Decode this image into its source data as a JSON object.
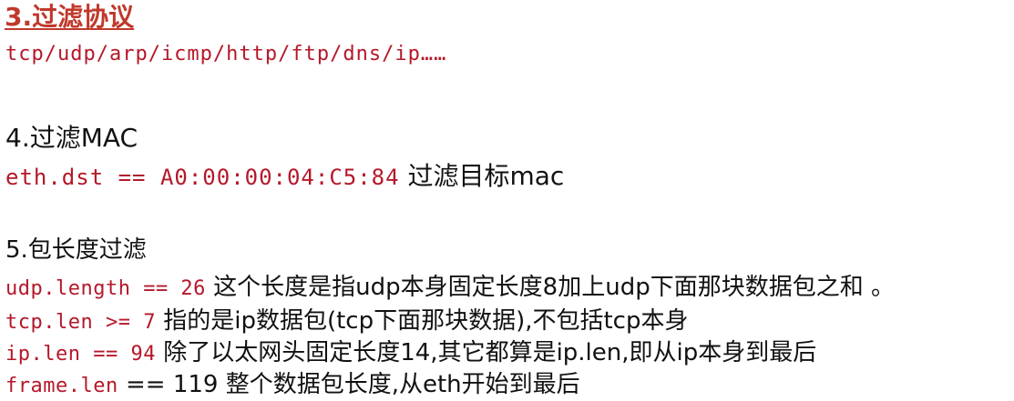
{
  "section3": {
    "heading": "3.过滤协议",
    "protocols": "tcp/udp/arp/icmp/http/ftp/dns/ip……"
  },
  "section4": {
    "heading": "4.过滤MAC",
    "code": "eth.dst == A0:00:00:04:C5:84",
    "description": " 过滤目标mac"
  },
  "section5": {
    "heading": "5.包长度过滤",
    "rows": [
      {
        "code": "udp.length == 26",
        "description": " 这个长度是指udp本身固定长度8加上udp下面那块数据包之和 。"
      },
      {
        "code": "tcp.len >= 7",
        "description": " 指的是ip数据包(tcp下面那块数据),不包括tcp本身"
      },
      {
        "code": "ip.len == 94",
        "description": " 除了以太网头固定长度14,其它都算是ip.len,即从ip本身到最后"
      },
      {
        "code": "frame.len",
        "description": " == 119 整个数据包长度,从eth开始到最后"
      }
    ]
  }
}
